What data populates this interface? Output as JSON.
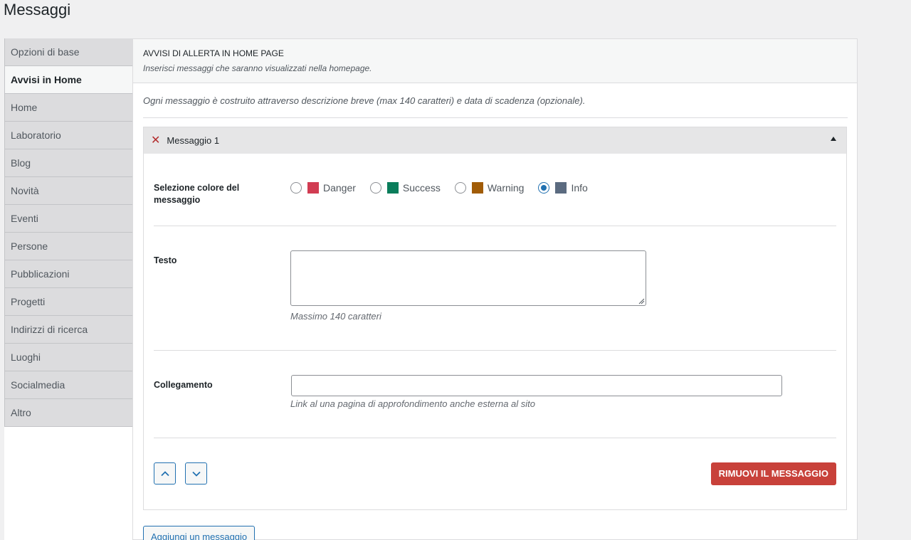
{
  "page": {
    "title": "Messaggi"
  },
  "sidebar": {
    "items": [
      {
        "label": "Opzioni di base",
        "active": false
      },
      {
        "label": "Avvisi in Home",
        "active": true
      },
      {
        "label": "Home",
        "active": false
      },
      {
        "label": "Laboratorio",
        "active": false
      },
      {
        "label": "Blog",
        "active": false
      },
      {
        "label": "Novità",
        "active": false
      },
      {
        "label": "Eventi",
        "active": false
      },
      {
        "label": "Persone",
        "active": false
      },
      {
        "label": "Pubblicazioni",
        "active": false
      },
      {
        "label": "Progetti",
        "active": false
      },
      {
        "label": "Indirizzi di ricerca",
        "active": false
      },
      {
        "label": "Luoghi",
        "active": false
      },
      {
        "label": "Socialmedia",
        "active": false
      },
      {
        "label": "Altro",
        "active": false
      }
    ]
  },
  "panel": {
    "title": "AVVISI DI ALLERTA IN HOME PAGE",
    "subtitle": "Inserisci messaggi che saranno visualizzati nella homepage.",
    "intro": "Ogni messaggio è costruito attraverso descrizione breve (max 140 caratteri) e data di scadenza (opzionale)."
  },
  "group": {
    "title": "Messaggio 1",
    "color_field": {
      "label": "Selezione colore del messaggio",
      "options": [
        {
          "label": "Danger",
          "color": "#d13c52",
          "checked": false
        },
        {
          "label": "Success",
          "color": "#0a7d5b",
          "checked": false
        },
        {
          "label": "Warning",
          "color": "#a15c07",
          "checked": false
        },
        {
          "label": "Info",
          "color": "#5b6b80",
          "checked": true
        }
      ]
    },
    "text_field": {
      "label": "Testo",
      "value": "",
      "help": "Massimo 140 caratteri"
    },
    "link_field": {
      "label": "Collegamento",
      "value": "",
      "help": "Link al una pagina di approfondimento anche esterna al sito"
    },
    "remove_label": "RIMUOVI IL MESSAGGIO"
  },
  "add_label": "Aggiungi un messaggio",
  "icons": {
    "close": "close-icon",
    "collapse": "triangle-up-icon",
    "move_up": "chevron-up-icon",
    "move_down": "chevron-down-icon"
  },
  "colors": {
    "accent": "#2271b1",
    "danger_button": "#c8413a"
  }
}
